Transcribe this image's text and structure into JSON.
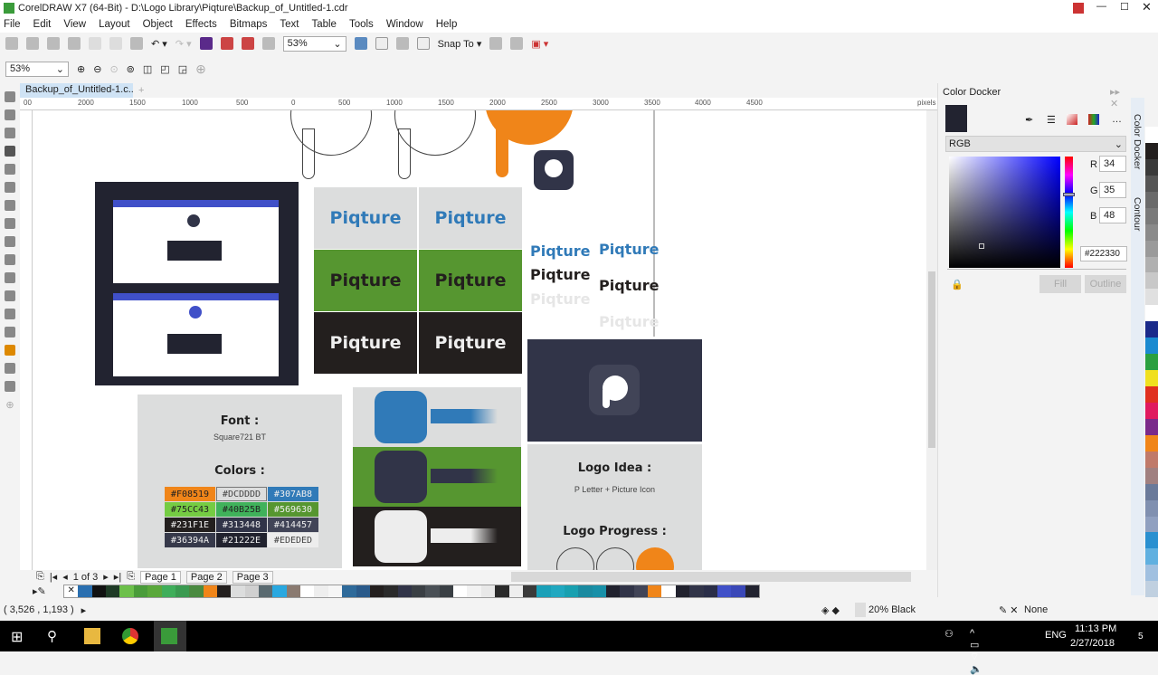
{
  "window": {
    "title": "CorelDRAW X7 (64-Bit) - D:\\Logo Library\\Piqture\\Backup_of_Untitled-1.cdr"
  },
  "menu": [
    "File",
    "Edit",
    "View",
    "Layout",
    "Object",
    "Effects",
    "Bitmaps",
    "Text",
    "Table",
    "Tools",
    "Window",
    "Help"
  ],
  "toolbar": {
    "zoom": "53%",
    "snap_to": "Snap To"
  },
  "propbar": {
    "zoom": "53%"
  },
  "document_tab": "Backup_of_Untitled-1.c...",
  "ruler": {
    "labels": [
      "2000",
      "1500",
      "1000",
      "500",
      "0",
      "500",
      "1000",
      "1500",
      "2000",
      "2500",
      "3000",
      "3500",
      "4000",
      "4500"
    ],
    "unit": "pixels"
  },
  "canvas": {
    "brand": "Piqture",
    "font_heading": "Font :",
    "font_name": "Square721 BT",
    "colors_heading": "Colors :",
    "swatches": [
      {
        "hex": "#F08519",
        "bg": "#F08519"
      },
      {
        "hex": "#DCDDDD",
        "bg": "#DCDDDD"
      },
      {
        "hex": "#307AB8",
        "bg": "#307AB8"
      },
      {
        "hex": "#75CC43",
        "bg": "#75CC43"
      },
      {
        "hex": "#40B25B",
        "bg": "#40B25B"
      },
      {
        "hex": "#569630",
        "bg": "#569630"
      },
      {
        "hex": "#231F1E",
        "bg": "#231F1E"
      },
      {
        "hex": "#313448",
        "bg": "#313448"
      },
      {
        "hex": "#414457",
        "bg": "#414457"
      },
      {
        "hex": "#36394A",
        "bg": "#36394A"
      },
      {
        "hex": "#21222E",
        "bg": "#21222E"
      },
      {
        "hex": "#EDEDED",
        "bg": "#EDEDED"
      }
    ],
    "logo_idea_heading": "Logo Idea :",
    "logo_idea": "P Letter + Picture Icon",
    "logo_progress_heading": "Logo Progress :"
  },
  "docker": {
    "title": "Color Docker",
    "model": "RGB",
    "r": "34",
    "g": "35",
    "b": "48",
    "hex": "#222330",
    "fill": "Fill",
    "outline": "Outline",
    "current_color": "#222330",
    "tabs": [
      "Color Docker",
      "Contour"
    ]
  },
  "pages": {
    "count": "1 of 3",
    "tabs": [
      "Page 1",
      "Page 2",
      "Page 3"
    ]
  },
  "palette": [
    "#2a6fb0",
    "#111111",
    "#1e3a25",
    "#6cc04a",
    "#4a9c3a",
    "#5aa83a",
    "#3fae5a",
    "#3a9a50",
    "#4a8a40",
    "#f08519",
    "#231f1e",
    "#dcdddd",
    "#d0d0d0",
    "#5a6a70",
    "#29a8e0",
    "#8a7a70",
    "#ffffff",
    "#eeeeee",
    "#f6f6f6",
    "#2e6a9a",
    "#2a5a8a",
    "#231f1e",
    "#2a2a2a",
    "#313448",
    "#3a3f44",
    "#4a5056",
    "#3a3f44",
    "#ffffff",
    "#f2f2f2",
    "#e8e8e8",
    "#2a2a2a",
    "#eeeeee",
    "#3a3a3a",
    "#1aa0b8",
    "#20a8c0",
    "#18a0b0",
    "#1a8aa0",
    "#1890a8",
    "#21222e",
    "#313448",
    "#414457",
    "#f08519",
    "#ffffff",
    "#21222e",
    "#313448",
    "#2a2e48",
    "#4050c8",
    "#3a48b8",
    "#222330"
  ],
  "right_palette": [
    "#ffffff",
    "#231f1e",
    "#3a3a3a",
    "#555555",
    "#6a6a6a",
    "#7a7a7a",
    "#8a8a8a",
    "#9a9a9a",
    "#b0b0b0",
    "#c8c8c8",
    "#e0e0e0",
    "#ffffff",
    "#1a2a8a",
    "#1a8ad0",
    "#2aa040",
    "#f0e020",
    "#e03020",
    "#e01a60",
    "#7a2a8a",
    "#f08519",
    "#c07a6a",
    "#a08080",
    "#6a7a9a",
    "#8090b0",
    "#90a0c0",
    "#2a90d0",
    "#60b0e0",
    "#a0c0e0",
    "#c0d0e0"
  ],
  "status": {
    "coords": "( 3,526 , 1,193 )",
    "fill": "20% Black",
    "outline": "None"
  },
  "taskbar": {
    "lang": "ENG",
    "time": "11:13 PM",
    "date": "2/27/2018",
    "notifications": "5"
  }
}
